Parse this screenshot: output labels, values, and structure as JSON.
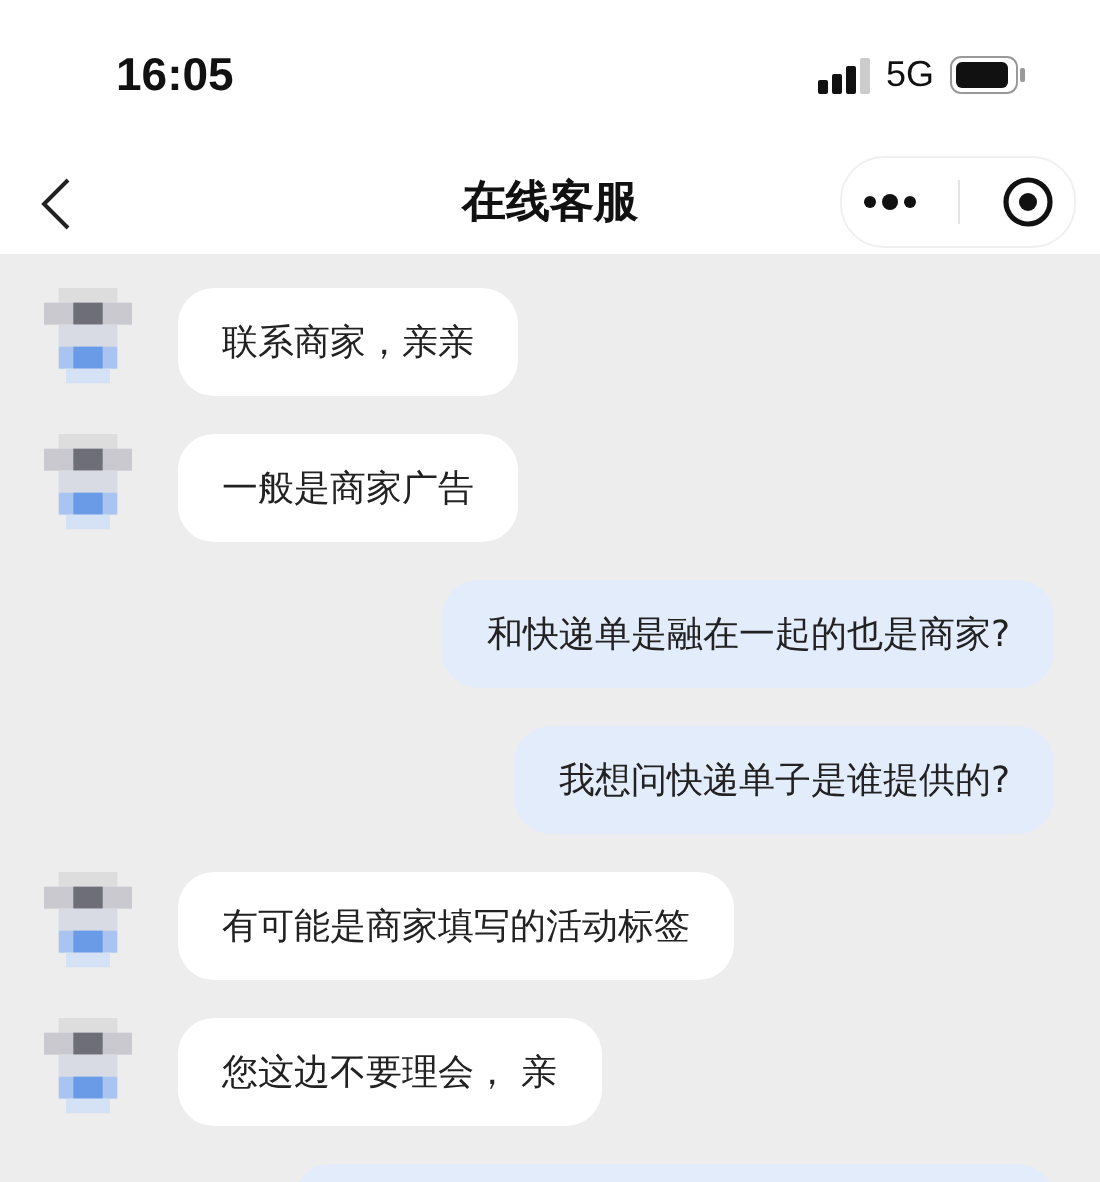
{
  "status_bar": {
    "time": "16:05",
    "network": "5G"
  },
  "nav": {
    "title": "在线客服"
  },
  "messages": [
    {
      "kind": "incoming",
      "text": "联系商家，亲亲"
    },
    {
      "kind": "incoming",
      "text": "一般是商家广告"
    },
    {
      "kind": "outgoing",
      "text": "和快递单是融在一起的也是商家?"
    },
    {
      "kind": "outgoing",
      "text": "我想问快递单子是谁提供的?"
    },
    {
      "kind": "incoming",
      "text": "有可能是商家填写的活动标签"
    },
    {
      "kind": "incoming",
      "text": "您这边不要理会， 亲"
    },
    {
      "kind": "outgoing"
    }
  ]
}
